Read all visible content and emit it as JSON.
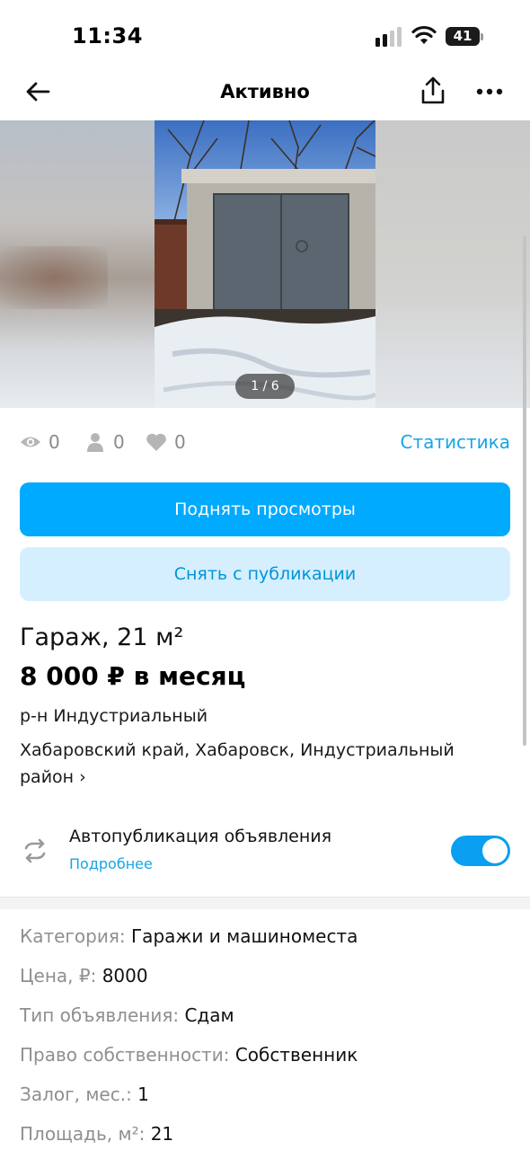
{
  "status_bar": {
    "time": "11:34",
    "battery": "41"
  },
  "nav": {
    "title": "Активно",
    "icons": [
      "back-arrow-icon",
      "share-icon",
      "more-icon"
    ]
  },
  "gallery": {
    "counter": "1 / 6"
  },
  "stats": {
    "views": "0",
    "contacts": "0",
    "favorites": "0",
    "link": "Статистика"
  },
  "buttons": {
    "promote": "Поднять просмотры",
    "unpublish": "Снять с публикации"
  },
  "listing": {
    "title": "Гараж, 21 м²",
    "price": "8 000 ₽ в месяц",
    "district": "р-н Индустриальный",
    "address": "Хабаровский край, Хабаровск, Индустриальный район ›"
  },
  "autopub": {
    "title": "Автопубликация объявления",
    "more": "Подробнее",
    "enabled": true
  },
  "params": [
    {
      "label": "Категория: ",
      "value": "Гаражи и машиноместа"
    },
    {
      "label": "Цена, ₽: ",
      "value": "8000"
    },
    {
      "label": "Тип объявления: ",
      "value": "Сдам"
    },
    {
      "label": "Право собственности: ",
      "value": "Собственник"
    },
    {
      "label": "Залог, мес.: ",
      "value": "1"
    },
    {
      "label": "Площадь, м²: ",
      "value": "21"
    }
  ],
  "colors": {
    "accent": "#00aaff",
    "accent_light": "#d5efff",
    "link": "#16a5e6",
    "toggle": "#0a9ff0"
  }
}
